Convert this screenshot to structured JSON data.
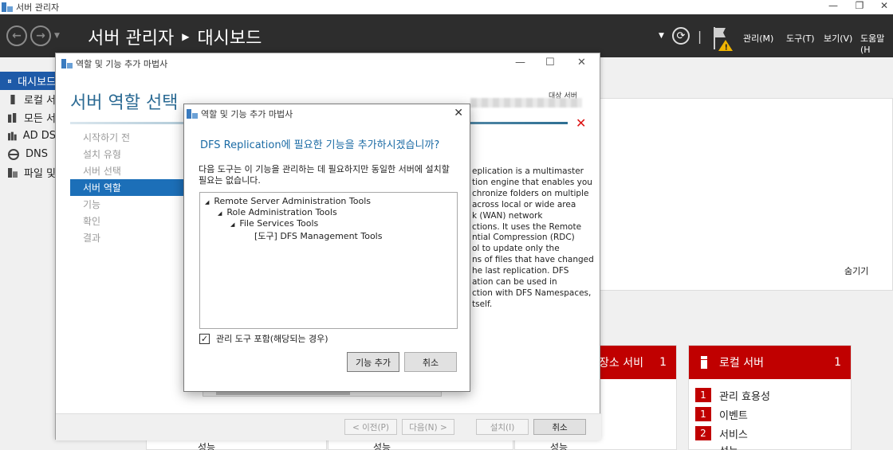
{
  "os_window": {
    "title": "서버 관리자"
  },
  "header": {
    "title": "서버 관리자",
    "page": "대시보드",
    "menu": [
      "관리(M)",
      "도구(T)",
      "보기(V)",
      "도움말(H"
    ]
  },
  "sm_nav": {
    "items": [
      {
        "label": "대시보드",
        "icon": "dashboard-icon"
      },
      {
        "label": "로컬 서",
        "icon": "local-server-icon"
      },
      {
        "label": "모든 서",
        "icon": "all-servers-icon"
      },
      {
        "label": "AD DS",
        "icon": "ad-ds-icon"
      },
      {
        "label": "DNS",
        "icon": "dns-icon"
      },
      {
        "label": "파일 및",
        "icon": "file-services-icon"
      }
    ]
  },
  "dashboard": {
    "hide_label": "숨기기",
    "tile_storage": {
      "title": "장소 서비",
      "count": "1"
    },
    "tile_local": {
      "title": "로컬 서버",
      "count": "1",
      "rows": [
        {
          "count": "1",
          "label": "관리 효용성"
        },
        {
          "count": "1",
          "label": "이벤트"
        },
        {
          "count": "2",
          "label": "서비스"
        },
        {
          "label": "성능"
        }
      ]
    },
    "performance_label": "성능"
  },
  "wizard": {
    "title": "역할 및 기능 추가 마법사",
    "heading": "서버 역할 선택",
    "target_server_label": "대상 서버",
    "steps": [
      "시작하기 전",
      "설치 유형",
      "서버 선택",
      "서버 역할",
      "기능",
      "확인",
      "결과"
    ],
    "description": "eplication is a multimaster\ntion engine that enables you\nchronize folders on multiple\n across local or wide area\nk (WAN) network\nctions. It uses the Remote\nntial Compression (RDC)\nol to update only the\nns of files that have changed\nhe last replication. DFS\nation can be used in\nction with DFS Namespaces,\ntself.",
    "buttons": {
      "prev": "< 이전(P)",
      "next": "다음(N) >",
      "install": "설치(I)",
      "cancel": "취소"
    }
  },
  "dialog": {
    "title": "역할 및 기능 추가 마법사",
    "question": "DFS Replication에 필요한 기능을 추가하시겠습니까?",
    "message": "다음 도구는 이 기능을 관리하는 데 필요하지만 동일한 서버에 설치할 필요는 없습니다.",
    "tree": [
      {
        "label": "Remote Server Administration Tools",
        "level": 0,
        "expanded": true
      },
      {
        "label": "Role Administration Tools",
        "level": 1,
        "expanded": true
      },
      {
        "label": "File Services Tools",
        "level": 2,
        "expanded": true
      },
      {
        "label": "[도구] DFS Management Tools",
        "level": 3,
        "expanded": false
      }
    ],
    "include_tools_label": "관리 도구 포함(해당되는 경우)",
    "include_tools_checked": true,
    "add_button": "기능 추가",
    "cancel_button": "취소"
  },
  "colors": {
    "accent": "#1c6fb8",
    "alert_red": "#c00000",
    "header_bg": "#2d2d2d",
    "title_blue": "#2c6b94"
  }
}
